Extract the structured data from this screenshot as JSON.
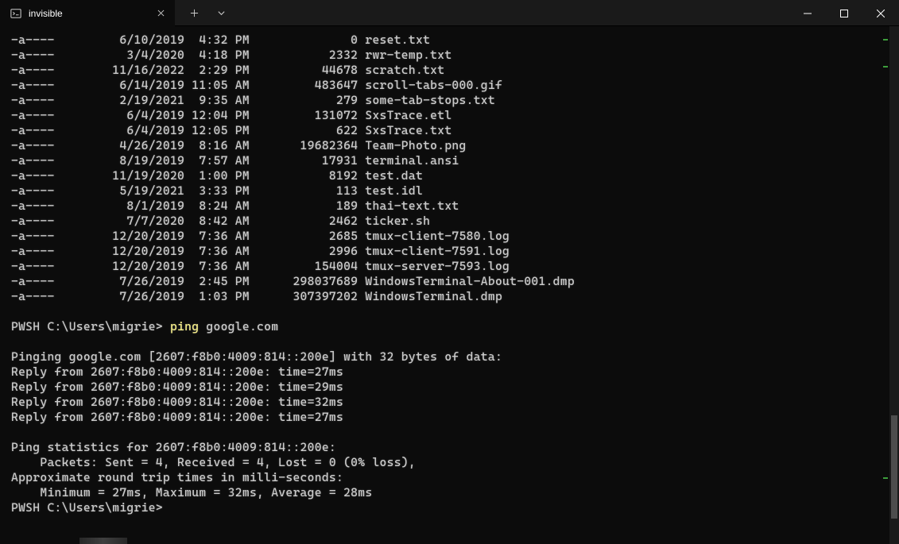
{
  "titlebar": {
    "tab_title": "invisible",
    "new_tab_label": "+",
    "dropdown_label": "⌄"
  },
  "files": [
    {
      "mode": "-a----",
      "date": "6/10/2019",
      "time": "4:32 PM",
      "size": "0",
      "name": "reset.txt"
    },
    {
      "mode": "-a----",
      "date": "3/4/2020",
      "time": "4:18 PM",
      "size": "2332",
      "name": "rwr-temp.txt"
    },
    {
      "mode": "-a----",
      "date": "11/16/2022",
      "time": "2:29 PM",
      "size": "44678",
      "name": "scratch.txt"
    },
    {
      "mode": "-a----",
      "date": "6/14/2019",
      "time": "11:05 AM",
      "size": "483647",
      "name": "scroll-tabs-000.gif"
    },
    {
      "mode": "-a----",
      "date": "2/19/2021",
      "time": "9:35 AM",
      "size": "279",
      "name": "some-tab-stops.txt"
    },
    {
      "mode": "-a----",
      "date": "6/4/2019",
      "time": "12:04 PM",
      "size": "131072",
      "name": "SxsTrace.etl"
    },
    {
      "mode": "-a----",
      "date": "6/4/2019",
      "time": "12:05 PM",
      "size": "622",
      "name": "SxsTrace.txt"
    },
    {
      "mode": "-a----",
      "date": "4/26/2019",
      "time": "8:16 AM",
      "size": "19682364",
      "name": "Team-Photo.png"
    },
    {
      "mode": "-a----",
      "date": "8/19/2019",
      "time": "7:57 AM",
      "size": "17931",
      "name": "terminal.ansi"
    },
    {
      "mode": "-a----",
      "date": "11/19/2020",
      "time": "1:00 PM",
      "size": "8192",
      "name": "test.dat"
    },
    {
      "mode": "-a----",
      "date": "5/19/2021",
      "time": "3:33 PM",
      "size": "113",
      "name": "test.idl"
    },
    {
      "mode": "-a----",
      "date": "8/1/2019",
      "time": "8:24 AM",
      "size": "189",
      "name": "thai-text.txt"
    },
    {
      "mode": "-a----",
      "date": "7/7/2020",
      "time": "8:42 AM",
      "size": "2462",
      "name": "ticker.sh"
    },
    {
      "mode": "-a----",
      "date": "12/20/2019",
      "time": "7:36 AM",
      "size": "2685",
      "name": "tmux-client-7580.log"
    },
    {
      "mode": "-a----",
      "date": "12/20/2019",
      "time": "7:36 AM",
      "size": "2996",
      "name": "tmux-client-7591.log"
    },
    {
      "mode": "-a----",
      "date": "12/20/2019",
      "time": "7:36 AM",
      "size": "154004",
      "name": "tmux-server-7593.log"
    },
    {
      "mode": "-a----",
      "date": "7/26/2019",
      "time": "2:45 PM",
      "size": "298037689",
      "name": "WindowsTerminal-About-001.dmp"
    },
    {
      "mode": "-a----",
      "date": "7/26/2019",
      "time": "1:03 PM",
      "size": "307397202",
      "name": "WindowsTerminal.dmp"
    }
  ],
  "prompt1": {
    "prefix": "PWSH ",
    "path": "C:\\Users\\migrie> ",
    "command": "ping",
    "args": " google.com"
  },
  "ping_output": {
    "header": "Pinging google.com [2607:f8b0:4009:814::200e] with 32 bytes of data:",
    "replies": [
      "Reply from 2607:f8b0:4009:814::200e: time=27ms",
      "Reply from 2607:f8b0:4009:814::200e: time=29ms",
      "Reply from 2607:f8b0:4009:814::200e: time=32ms",
      "Reply from 2607:f8b0:4009:814::200e: time=27ms"
    ],
    "stats_header": "Ping statistics for 2607:f8b0:4009:814::200e:",
    "packets": "    Packets: Sent = 4, Received = 4, Lost = 0 (0% loss),",
    "rtt_header": "Approximate round trip times in milli-seconds:",
    "rtt_values": "    Minimum = 27ms, Maximum = 32ms, Average = 28ms"
  },
  "prompt2": {
    "prefix": "PWSH ",
    "path": "C:\\Users\\migrie>"
  }
}
